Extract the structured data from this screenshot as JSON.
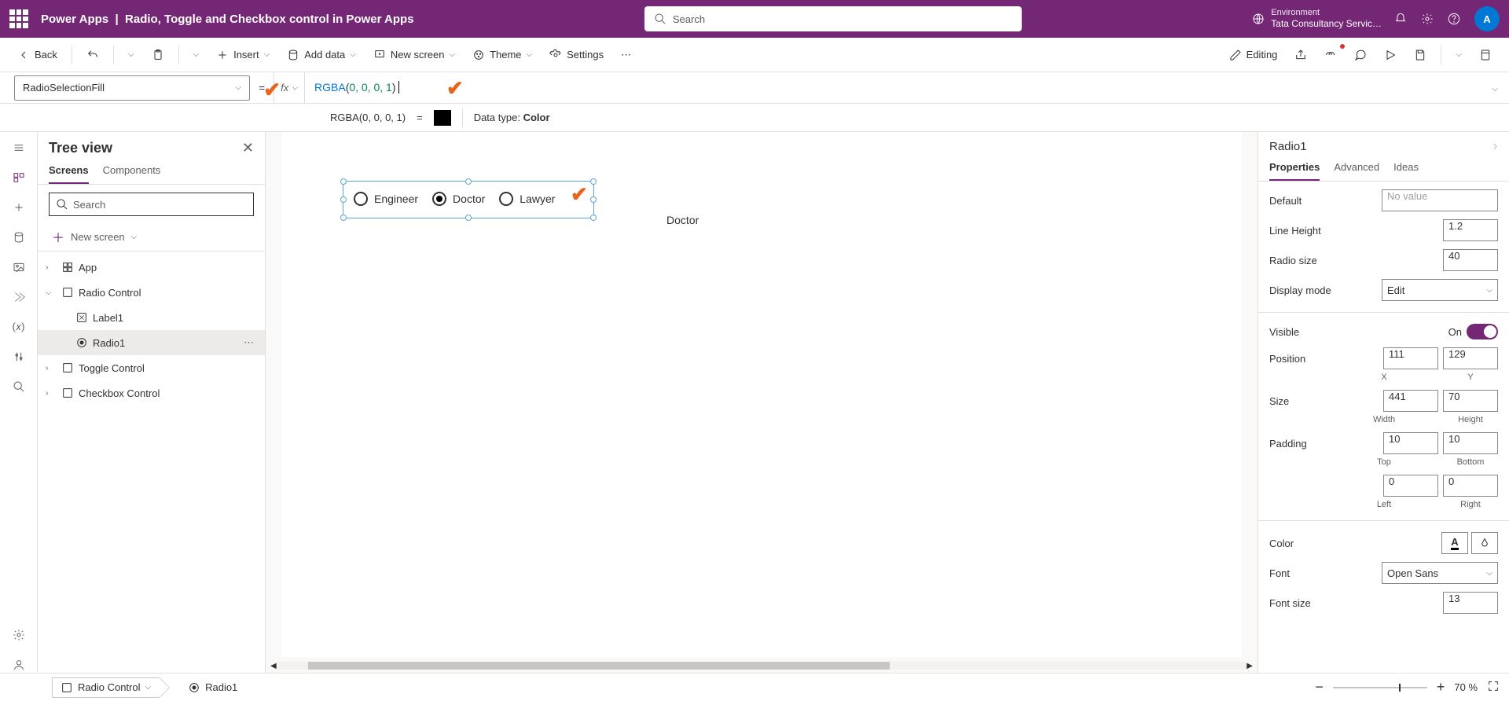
{
  "header": {
    "app_name": "Power Apps",
    "title_sep": "|",
    "doc_title": "Radio, Toggle and Checkbox control in Power Apps",
    "search_placeholder": "Search",
    "env_label": "Environment",
    "env_value": "Tata Consultancy Servic…",
    "avatar_letter": "A"
  },
  "cmdbar": {
    "back": "Back",
    "insert": "Insert",
    "add_data": "Add data",
    "new_screen": "New screen",
    "theme": "Theme",
    "settings": "Settings",
    "editing": "Editing"
  },
  "formula": {
    "property": "RadioSelectionFill",
    "fx": "fx",
    "fn_name": "RGBA",
    "args": "0, 0, 0, 1",
    "result_label": "RGBA(0, 0, 0, 1)",
    "equals": "=",
    "datatype_label": "Data type:",
    "datatype_value": "Color"
  },
  "tree": {
    "title": "Tree view",
    "tab_screens": "Screens",
    "tab_components": "Components",
    "search_placeholder": "Search",
    "new_screen": "New screen",
    "nodes": {
      "app": "App",
      "radio_control": "Radio Control",
      "label1": "Label1",
      "radio1": "Radio1",
      "toggle_control": "Toggle Control",
      "checkbox_control": "Checkbox Control"
    }
  },
  "canvas": {
    "options": [
      "Engineer",
      "Doctor",
      "Lawyer"
    ],
    "selected_index": 1,
    "label_value": "Doctor"
  },
  "properties": {
    "control_name": "Radio1",
    "tab_properties": "Properties",
    "tab_advanced": "Advanced",
    "tab_ideas": "Ideas",
    "default_label": "Default",
    "default_value": "No value",
    "line_height_label": "Line Height",
    "line_height_value": "1.2",
    "radio_size_label": "Radio size",
    "radio_size_value": "40",
    "display_mode_label": "Display mode",
    "display_mode_value": "Edit",
    "visible_label": "Visible",
    "visible_value": "On",
    "position_label": "Position",
    "pos_x": "111",
    "pos_y": "129",
    "pos_x_lbl": "X",
    "pos_y_lbl": "Y",
    "size_label": "Size",
    "size_w": "441",
    "size_h": "70",
    "size_w_lbl": "Width",
    "size_h_lbl": "Height",
    "padding_label": "Padding",
    "pad_top": "10",
    "pad_bottom": "10",
    "pad_top_lbl": "Top",
    "pad_bottom_lbl": "Bottom",
    "pad_left": "0",
    "pad_right": "0",
    "pad_left_lbl": "Left",
    "pad_right_lbl": "Right",
    "color_label": "Color",
    "font_label": "Font",
    "font_value": "Open Sans",
    "font_size_label": "Font size",
    "font_size_value": "13"
  },
  "breadcrumb": {
    "screen": "Radio Control",
    "control": "Radio1"
  },
  "zoom": {
    "percent": "70",
    "unit": "%"
  }
}
